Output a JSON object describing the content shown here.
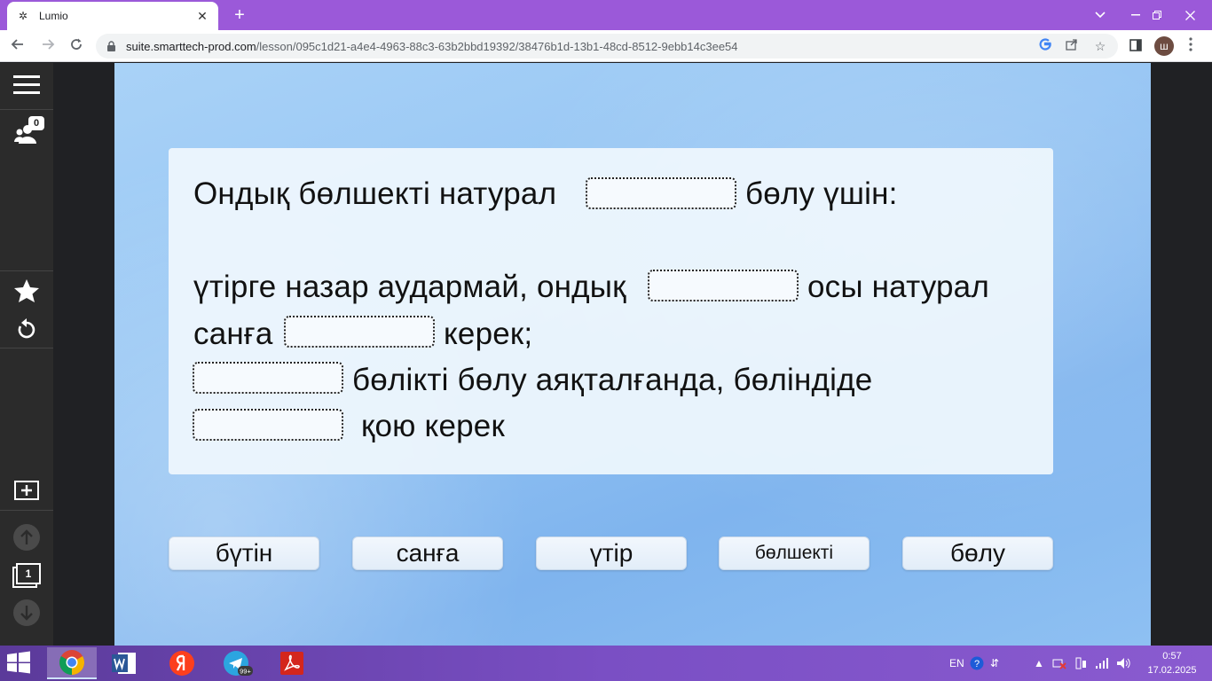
{
  "browser": {
    "tab_title": "Lumio",
    "new_tab": "+",
    "url_host": "suite.smarttech-prod.com",
    "url_path": "/lesson/095c1d21-a4e4-4963-88c3-63b2bbd19392/38476b1d-13b1-48cd-8512-9ebb14c3ee54",
    "profile_initial": "ш"
  },
  "sidebar": {
    "participants_count": "0",
    "page_number": "1"
  },
  "lesson": {
    "line1_a": "Ондық бөлшекті  натурал",
    "line1_b": "бөлу үшін:",
    "line2_a": "үтірге назар аудармай, ондық",
    "line2_b": "осы натурал",
    "line3_a": "санға",
    "line3_b": "керек;",
    "line4": "бөлікті бөлу аяқталғанда, бөліндіде",
    "line5": "қою керек",
    "words": [
      "бүтін",
      "санға",
      "үтір",
      "бөлшекті",
      "бөлу"
    ]
  },
  "taskbar": {
    "lang": "EN",
    "time": "0:57",
    "date": "17.02.2025",
    "telegram_badge": "99+"
  },
  "colors": {
    "tab_strip": "#9b59d9",
    "sidebar": "#2b2b2b",
    "canvas": "#94c4f3",
    "taskbar": "#7a4fc4"
  }
}
